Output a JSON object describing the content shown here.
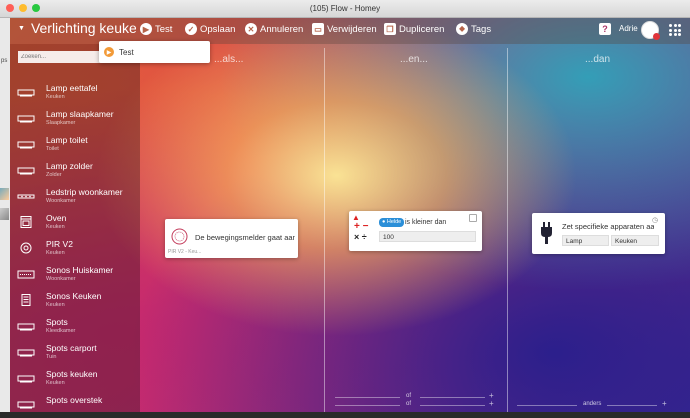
{
  "window": {
    "title": "(105) Flow - Homey"
  },
  "left_fragment": {
    "text": "ps"
  },
  "flow": {
    "title": "Verlichting keuken"
  },
  "toolbar": {
    "test": "Test",
    "save": "Opslaan",
    "cancel": "Annuleren",
    "delete": "Verwijderen",
    "duplicate": "Dupliceren",
    "tags": "Tags"
  },
  "user": {
    "name": "Adrie"
  },
  "test_popup": {
    "label": "Test"
  },
  "search": {
    "placeholder": "Zoeken..."
  },
  "devices": [
    {
      "name": "Lamp eettafel",
      "zone": "Keuken"
    },
    {
      "name": "Lamp slaapkamer",
      "zone": "Slaapkamer"
    },
    {
      "name": "Lamp toilet",
      "zone": "Toilet"
    },
    {
      "name": "Lamp zolder",
      "zone": "Zolder"
    },
    {
      "name": "Ledstrip woonkamer",
      "zone": "Woonkamer"
    },
    {
      "name": "Oven",
      "zone": "Keuken"
    },
    {
      "name": "PIR V2",
      "zone": "Keuken"
    },
    {
      "name": "Sonos Huiskamer",
      "zone": "Woonkamer"
    },
    {
      "name": "Sonos Keuken",
      "zone": "Keuken"
    },
    {
      "name": "Spots",
      "zone": "Kleedkamer"
    },
    {
      "name": "Spots carport",
      "zone": "Tuin"
    },
    {
      "name": "Spots keuken",
      "zone": "Keuken"
    },
    {
      "name": "Spots overstek",
      "zone": ""
    }
  ],
  "columns": {
    "when": "...als...",
    "and": "...en...",
    "then": "...dan"
  },
  "when_card": {
    "text": "De bewegingsmelder gaat aan",
    "subtitle": "PIR V2 - Keu..."
  },
  "and_card": {
    "tag": "Helde",
    "text": "is kleiner dan",
    "value": "100"
  },
  "then_card": {
    "text": "Zet specifieke apparaten aan",
    "field1": "Lamp",
    "field2": "Keuken"
  },
  "bottom": {
    "or1": "of",
    "or2": "of",
    "else": "anders"
  }
}
